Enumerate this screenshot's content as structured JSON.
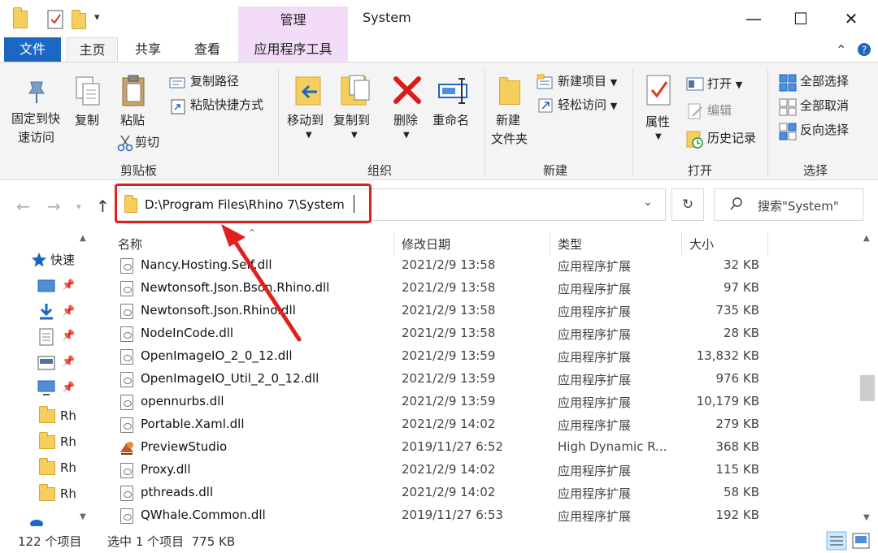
{
  "window": {
    "title": "System",
    "context_tab": "管理",
    "controls": {
      "minimize": "—",
      "maximize": "☐",
      "close": "✕"
    }
  },
  "ribbon_tabs": [
    "文件",
    "主页",
    "共享",
    "查看",
    "应用程序工具"
  ],
  "ribbon": {
    "clipboard": {
      "pin_label_line1": "固定到快",
      "pin_label_line2": "速访问",
      "copy": "复制",
      "paste": "粘贴",
      "copy_path": "复制路径",
      "paste_shortcut": "粘贴快捷方式",
      "cut": "剪切",
      "group": "剪贴板"
    },
    "organize": {
      "move_to": "移动到",
      "copy_to": "复制到",
      "delete": "删除",
      "rename": "重命名",
      "group": "组织"
    },
    "new": {
      "new_folder_line1": "新建",
      "new_folder_line2": "文件夹",
      "new_item": "新建项目",
      "easy_access": "轻松访问",
      "group": "新建"
    },
    "open": {
      "properties": "属性",
      "open": "打开",
      "edit": "编辑",
      "history": "历史记录",
      "group": "打开"
    },
    "select": {
      "select_all": "全部选择",
      "select_none": "全部取消",
      "invert": "反向选择",
      "group": "选择"
    }
  },
  "address": {
    "path": "D:\\Program Files\\Rhino 7\\System",
    "search_placeholder": "搜索\"System\""
  },
  "nav_pane": {
    "quick_access": "快速",
    "folders": [
      "Rh",
      "Rh",
      "Rh",
      "Rh"
    ]
  },
  "columns": {
    "name": "名称",
    "date": "修改日期",
    "type": "类型",
    "size": "大小"
  },
  "files": [
    {
      "name": "Nancy.Hosting.Self.dll",
      "date": "2021/2/9 13:58",
      "type": "应用程序扩展",
      "size": "32 KB",
      "icon": "dll-icon"
    },
    {
      "name": "Newtonsoft.Json.Bson.Rhino.dll",
      "date": "2021/2/9 13:58",
      "type": "应用程序扩展",
      "size": "97 KB",
      "icon": "dll-icon"
    },
    {
      "name": "Newtonsoft.Json.Rhino.dll",
      "date": "2021/2/9 13:58",
      "type": "应用程序扩展",
      "size": "735 KB",
      "icon": "dll-icon"
    },
    {
      "name": "NodeInCode.dll",
      "date": "2021/2/9 13:58",
      "type": "应用程序扩展",
      "size": "28 KB",
      "icon": "dll-icon"
    },
    {
      "name": "OpenImageIO_2_0_12.dll",
      "date": "2021/2/9 13:59",
      "type": "应用程序扩展",
      "size": "13,832 KB",
      "icon": "dll-icon"
    },
    {
      "name": "OpenImageIO_Util_2_0_12.dll",
      "date": "2021/2/9 13:59",
      "type": "应用程序扩展",
      "size": "976 KB",
      "icon": "dll-icon"
    },
    {
      "name": "opennurbs.dll",
      "date": "2021/2/9 13:59",
      "type": "应用程序扩展",
      "size": "10,179 KB",
      "icon": "dll-icon"
    },
    {
      "name": "Portable.Xaml.dll",
      "date": "2021/2/9 14:02",
      "type": "应用程序扩展",
      "size": "279 KB",
      "icon": "dll-icon"
    },
    {
      "name": "PreviewStudio",
      "date": "2019/11/27 6:52",
      "type": "High Dynamic R...",
      "size": "368 KB",
      "icon": "preview-studio-icon"
    },
    {
      "name": "Proxy.dll",
      "date": "2021/2/9 14:02",
      "type": "应用程序扩展",
      "size": "115 KB",
      "icon": "dll-icon"
    },
    {
      "name": "pthreads.dll",
      "date": "2021/2/9 14:02",
      "type": "应用程序扩展",
      "size": "58 KB",
      "icon": "dll-icon"
    },
    {
      "name": "QWhale.Common.dll",
      "date": "2019/11/27 6:53",
      "type": "应用程序扩展",
      "size": "192 KB",
      "icon": "dll-icon"
    }
  ],
  "status": {
    "count": "122 个项目",
    "selection": "选中 1 个项目  775 KB"
  },
  "colors": {
    "file_tab": "#1c67c2",
    "context_tab": "#f3dcf8",
    "highlight": "#e01f1f",
    "ribbon_bg": "#f4f4f4"
  }
}
